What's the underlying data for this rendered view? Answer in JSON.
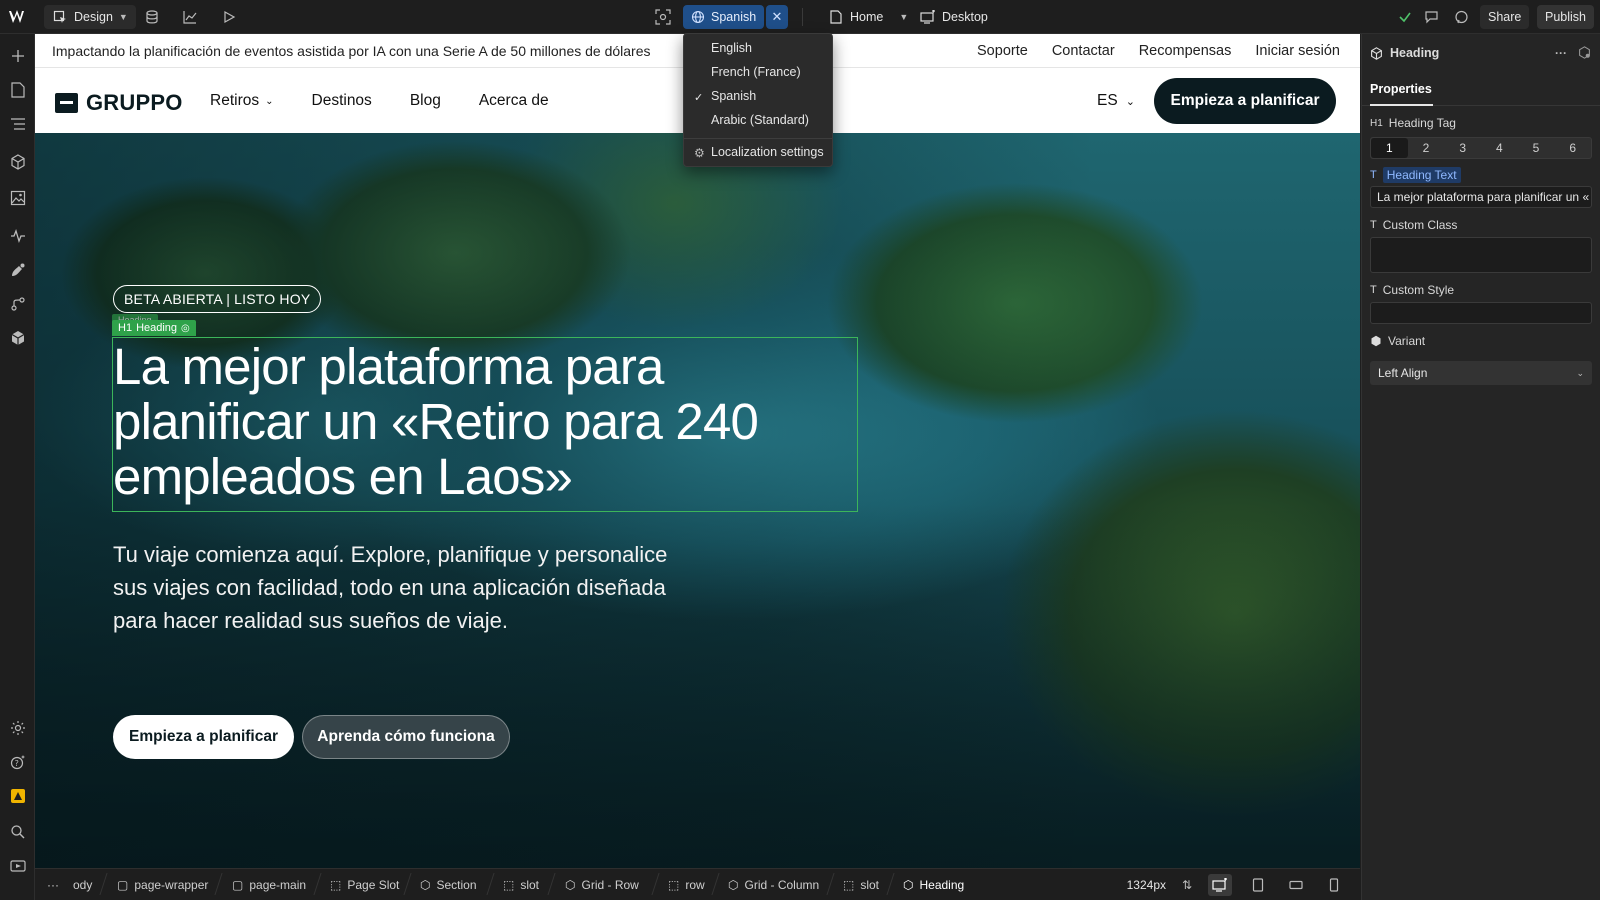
{
  "topbar": {
    "mode_label": "Design",
    "locale_label": "Spanish",
    "page_label": "Home",
    "breakpoint_label": "Desktop",
    "share_label": "Share",
    "publish_label": "Publish"
  },
  "locale_menu": {
    "items": [
      "English",
      "French (France)",
      "Spanish",
      "Arabic (Standard)"
    ],
    "selected": "Spanish",
    "settings_label": "Localization settings"
  },
  "site": {
    "announcement": "Impactando la planificación de eventos asistida por IA con una Serie A de 50 millones de dólares",
    "util_links": [
      "Soporte",
      "Contactar",
      "Recompensas",
      "Iniciar sesión"
    ],
    "logo_text": "GRUPPO",
    "nav": [
      "Retiros",
      "Destinos",
      "Blog",
      "Acerca de"
    ],
    "lang_code": "ES",
    "cta_label": "Empieza a planificar",
    "hero": {
      "badge": "BETA ABIERTA | LISTO HOY",
      "selection_tag": "Heading",
      "selection_tag_prefix": "H1",
      "ghost_tag": "Heading",
      "heading": "La mejor plataforma para planificar un «Retiro para 240 empleados en Laos»",
      "subheading": "Tu viaje comienza aquí. Explore, planifique y personalice sus viajes con facilidad, todo en una aplicación diseñada para hacer realidad sus sueños de viaje.",
      "primary_button": "Empieza a planificar",
      "secondary_button": "Aprenda cómo funciona"
    }
  },
  "panel": {
    "title": "Heading",
    "tab": "Properties",
    "heading_tag_label": "Heading Tag",
    "heading_tag_prefix": "H1",
    "heading_levels": [
      "1",
      "2",
      "3",
      "4",
      "5",
      "6"
    ],
    "heading_text_label": "Heading Text",
    "heading_text_value": "La mejor plataforma para planificar un «",
    "custom_class_label": "Custom Class",
    "custom_style_label": "Custom Style",
    "variant_label": "Variant",
    "variant_value": "Left Align"
  },
  "breadcrumbs": [
    "ody",
    "page-wrapper",
    "page-main",
    "Page Slot",
    "Section",
    "slot",
    "Grid - Row",
    "row",
    "Grid - Column",
    "slot",
    "Heading"
  ],
  "bottombar": {
    "ellipsis": "···",
    "width_readout": "1324px"
  }
}
